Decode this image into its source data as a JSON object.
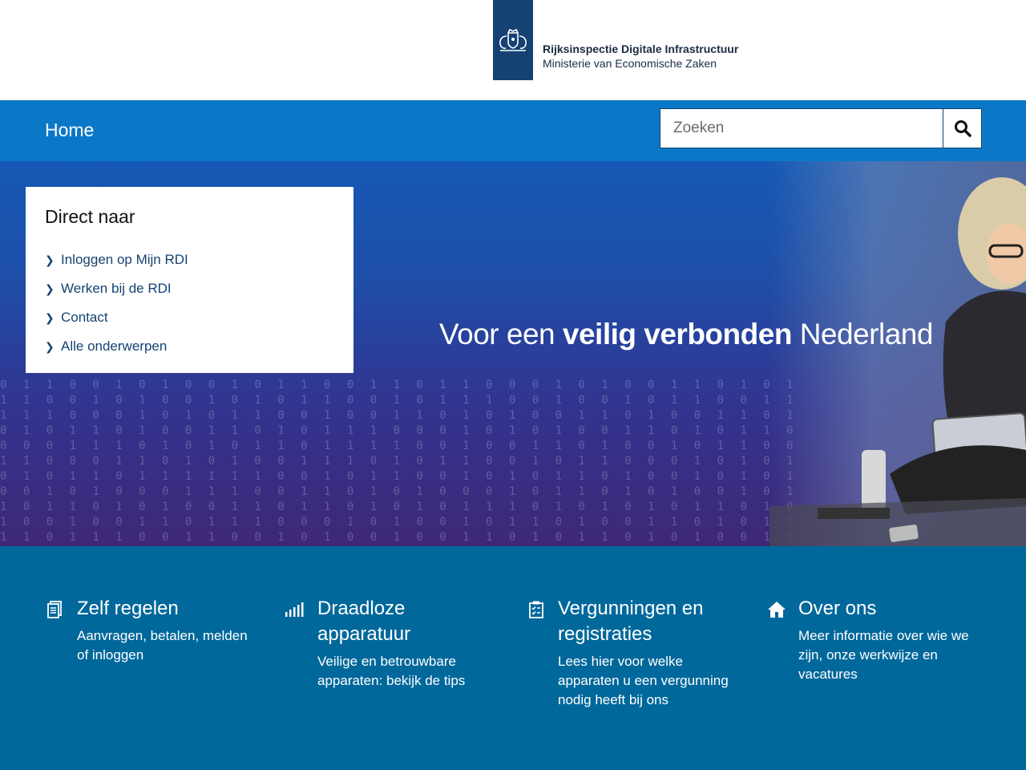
{
  "header": {
    "org_name": "Rijksinspectie Digitale Infrastructuur",
    "ministry": "Ministerie van Economische Zaken"
  },
  "nav": {
    "home_label": "Home",
    "search_placeholder": "Zoeken",
    "search_icon": "search-icon"
  },
  "hero": {
    "title_part1": "Voor een ",
    "title_bold": "veilig verbonden",
    "title_part2": " Nederland"
  },
  "direct_naar": {
    "title": "Direct naar",
    "links": [
      {
        "label": "Inloggen op Mijn RDI"
      },
      {
        "label": "Werken bij de RDI"
      },
      {
        "label": "Contact"
      },
      {
        "label": "Alle onderwerpen"
      }
    ]
  },
  "cards": [
    {
      "icon": "document-icon",
      "title": "Zelf regelen",
      "text": "Aanvragen, betalen, melden of inloggen"
    },
    {
      "icon": "signal-icon",
      "title": "Draadloze apparatuur",
      "text": "Veilige en betrouwbare apparaten: bekijk de tips"
    },
    {
      "icon": "clipboard-icon",
      "title": "Vergunningen en registraties",
      "text": "Lees hier voor welke apparaten u een vergunning nodig heeft bij ons"
    },
    {
      "icon": "home-icon",
      "title": "Over ons",
      "text": "Meer informatie over wie we zijn, onze werkwijze en vacatures"
    }
  ],
  "colors": {
    "logo_blue": "#154273",
    "nav_blue": "#0b78c7",
    "bottom_blue": "#01689b"
  }
}
